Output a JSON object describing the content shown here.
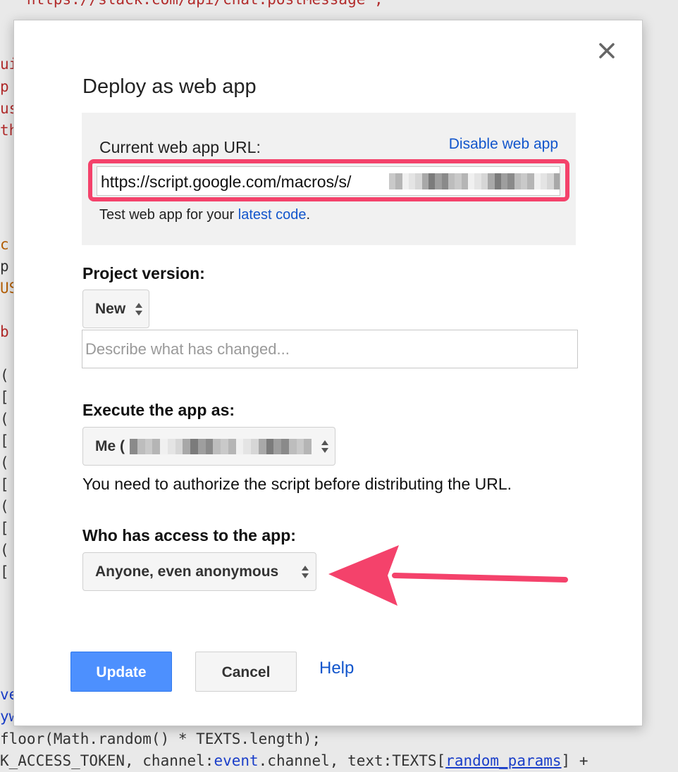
{
  "background_code": {
    "top_line": "  \"https://slack.com/api/chat.postMessage\";",
    "left_chars": [
      {
        "text": "ui",
        "color": "red"
      },
      {
        "text": "p",
        "color": "red"
      },
      {
        "text": "us",
        "color": "red"
      },
      {
        "text": "th",
        "color": "red"
      },
      {
        "text": "c",
        "color": "orange"
      },
      {
        "text": "p",
        "color": "dark"
      },
      {
        "text": "US",
        "color": "orange"
      },
      {
        "text": "b",
        "color": "red"
      },
      {
        "text": "(",
        "color": "dark"
      },
      {
        "text": "[",
        "color": "dark"
      },
      {
        "text": "(",
        "color": "dark"
      },
      {
        "text": "[",
        "color": "dark"
      },
      {
        "text": "(",
        "color": "dark"
      },
      {
        "text": "[",
        "color": "dark"
      },
      {
        "text": "(",
        "color": "dark"
      },
      {
        "text": "[",
        "color": "dark"
      },
      {
        "text": "(",
        "color": "dark"
      },
      {
        "text": "[",
        "color": "dark"
      },
      {
        "text": "ve",
        "color": "blue"
      },
      {
        "text": "yw",
        "color": "blue"
      }
    ],
    "bottom_line_1": "floor(Math.random() * TEXTS.length);",
    "bottom_line_2_prefix": "K_ACCESS_TOKEN, channel:",
    "bottom_line_2_event": "event",
    "bottom_line_2_mid": ".channel, text:TEXTS[",
    "bottom_line_2_param": "random_params",
    "bottom_line_2_suffix": "] +"
  },
  "dialog": {
    "title": "Deploy as web app",
    "close_icon": "close-icon",
    "url_section": {
      "label": "Current web app URL:",
      "disable_link": "Disable web app",
      "url_visible": "https://script.google.com/macros/s/",
      "note_prefix": "Test web app for your ",
      "note_link": "latest code",
      "note_suffix": "."
    },
    "project_version": {
      "label": "Project version:",
      "selected": "New",
      "describe_placeholder": "Describe what has changed..."
    },
    "execute_as": {
      "label": "Execute the app as:",
      "selected_prefix": "Me (",
      "note": "You need to authorize the script before distributing the URL."
    },
    "access": {
      "label": "Who has access to the app:",
      "selected": "Anyone, even anonymous"
    },
    "buttons": {
      "update": "Update",
      "cancel": "Cancel",
      "help": "Help"
    }
  },
  "colors": {
    "highlight": "#f4426b",
    "link": "#1155cc",
    "primary_button": "#4d90fe"
  }
}
